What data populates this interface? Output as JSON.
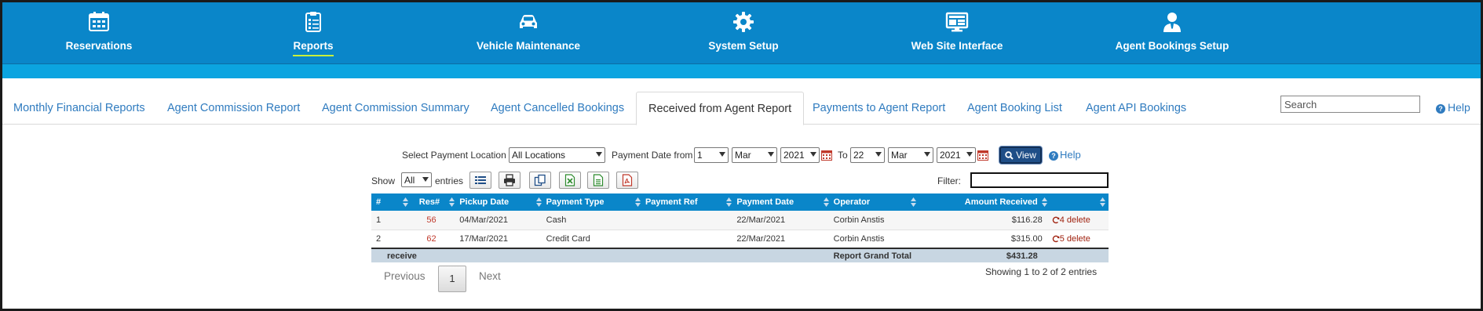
{
  "nav": {
    "items": [
      {
        "label": "Reservations",
        "icon": "calendar-icon"
      },
      {
        "label": "Reports",
        "icon": "clipboard-icon",
        "active": true
      },
      {
        "label": "Vehicle Maintenance",
        "icon": "car-icon"
      },
      {
        "label": "System Setup",
        "icon": "gear-icon"
      },
      {
        "label": "Web Site Interface",
        "icon": "monitor-icon"
      },
      {
        "label": "Agent Bookings Setup",
        "icon": "user-icon"
      }
    ]
  },
  "tabs": [
    {
      "label": "Monthly Financial Reports"
    },
    {
      "label": "Agent Commission Report"
    },
    {
      "label": "Agent Commission Summary"
    },
    {
      "label": "Agent Cancelled Bookings"
    },
    {
      "label": "Received from Agent Report",
      "active": true
    },
    {
      "label": "Payments to Agent Report"
    },
    {
      "label": "Agent Booking List"
    },
    {
      "label": "Agent API Bookings"
    }
  ],
  "search": {
    "placeholder": "Search"
  },
  "help_label": "Help",
  "filters": {
    "location_label": "Select Payment Location",
    "location_value": "All Locations",
    "date_from_label": "Payment Date from",
    "from": {
      "day": "1",
      "month": "Mar",
      "year": "2021"
    },
    "to_label": "To",
    "to": {
      "day": "22",
      "month": "Mar",
      "year": "2021"
    },
    "view_label": "View",
    "help_label": "Help"
  },
  "toolbar": {
    "show_label": "Show",
    "show_value": "All",
    "entries_label": "entries",
    "filter_label": "Filter:"
  },
  "table": {
    "columns": [
      "#",
      "Res#",
      "Pickup Date",
      "Payment Type",
      "Payment Ref",
      "Payment Date",
      "Operator",
      "Amount Received",
      ""
    ],
    "rows": [
      {
        "n": "1",
        "res": "56",
        "pickup": "04/Mar/2021",
        "type": "Cash",
        "ref": "",
        "paydate": "22/Mar/2021",
        "operator": "Corbin Anstis",
        "amount": "$116.28",
        "action": "4 delete"
      },
      {
        "n": "2",
        "res": "62",
        "pickup": "17/Mar/2021",
        "type": "Credit Card",
        "ref": "",
        "paydate": "22/Mar/2021",
        "operator": "Corbin Anstis",
        "amount": "$315.00",
        "action": "5 delete"
      }
    ],
    "footer": {
      "left": "receive",
      "total_label": "Report Grand Total",
      "total": "$431.28"
    }
  },
  "pagination": {
    "previous": "Previous",
    "current": "1",
    "next": "Next",
    "info": "Showing 1 to 2 of 2 entries"
  },
  "colors": {
    "nav_bg": "#0a86c9",
    "sub_band": "#0ba4e0",
    "link": "#2f7bbf",
    "active_underline": "#c8f03a",
    "view_button": "#1f4e87",
    "res_number": "#c0392b",
    "total_row": "#c8d6e2"
  }
}
